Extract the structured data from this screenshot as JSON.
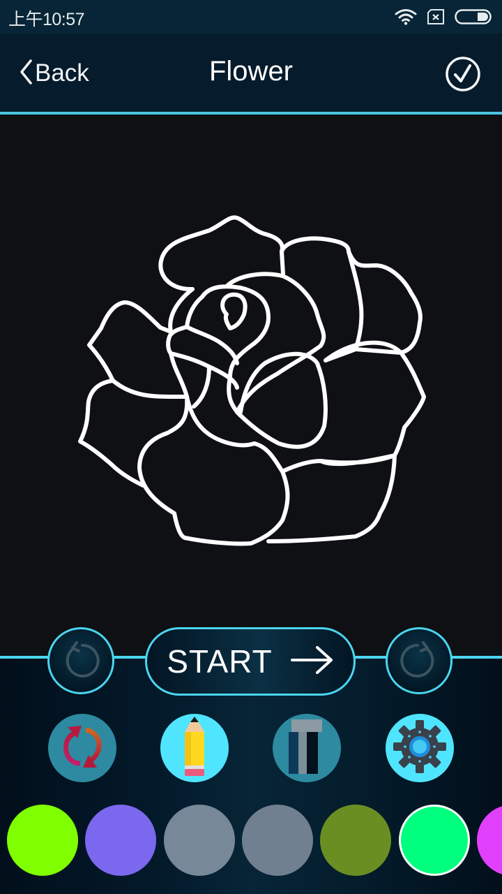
{
  "status_bar": {
    "time": "上午10:57",
    "icons": [
      "wifi-icon",
      "no-sim-icon",
      "battery-icon"
    ],
    "battery_level": 0.3
  },
  "nav": {
    "back_label": "Back",
    "title": "Flower",
    "confirm_icon": "check-circle-icon"
  },
  "canvas": {
    "drawing": "rose-outline",
    "stroke_color": "#ffffff",
    "background": "#0f1013"
  },
  "controls": {
    "undo_icon": "undo-icon",
    "start_label": "START",
    "start_icon": "arrow-right-icon",
    "redo_icon": "redo-icon"
  },
  "tools": [
    {
      "name": "reset",
      "icon": "refresh-icon",
      "active": false
    },
    {
      "name": "pencil",
      "icon": "pencil-icon",
      "active": true
    },
    {
      "name": "thickness",
      "icon": "line-thickness-icon",
      "active": false
    },
    {
      "name": "settings",
      "icon": "gear-icon",
      "active": true
    }
  ],
  "palette": {
    "colors": [
      "#80ff00",
      "#7b68ee",
      "#778899",
      "#708090",
      "#6b8e23",
      "#00ff7f",
      "#e040fb"
    ],
    "selected_index": 5
  },
  "accent_color": "#4ad6ef"
}
